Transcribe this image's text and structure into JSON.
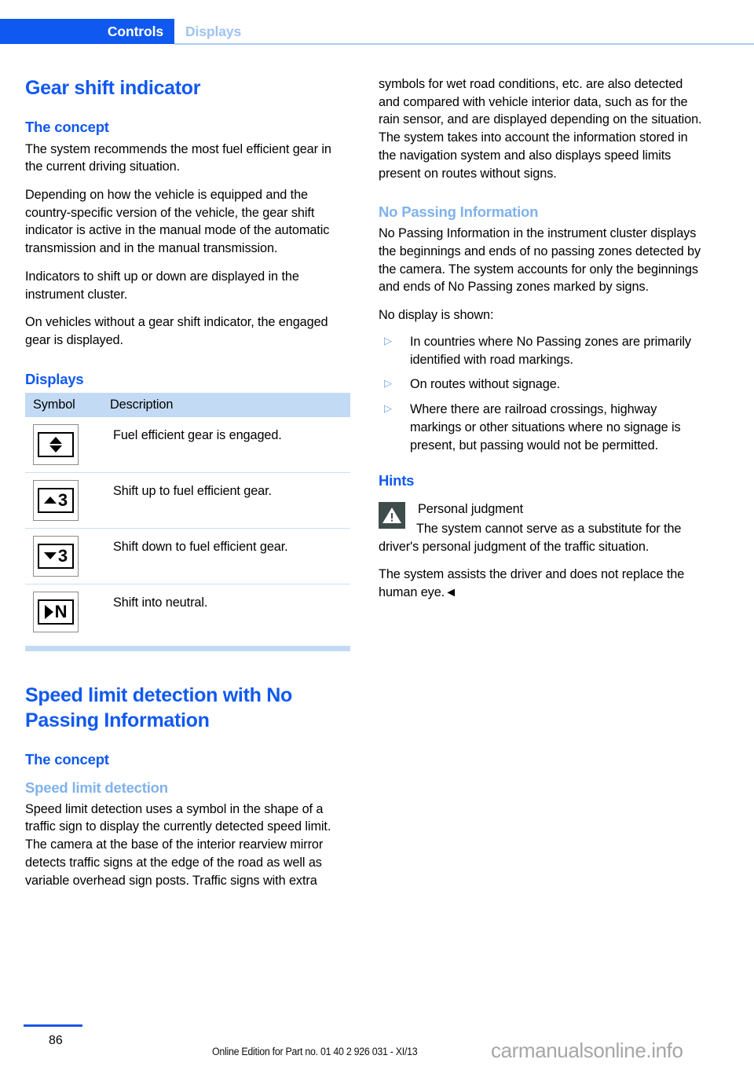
{
  "header": {
    "active_tab": "Controls",
    "inactive_tab": "Displays",
    "accent_blue": "#1059f0",
    "muted_blue": "#9fc3f2"
  },
  "left_column": {
    "title": "Gear shift indicator",
    "concept_heading": "The concept",
    "concept_paragraphs": [
      "The system recommends the most fuel efficient gear in the current driving situation.",
      "Depending on how the vehicle is equipped and the country-specific version of the vehicle, the gear shift indicator is active in the manual mode of the automatic transmission and in the manual transmission.",
      "Indicators to shift up or down are displayed in the instrument cluster.",
      "On vehicles without a gear shift indicator, the engaged gear is displayed."
    ],
    "displays_heading": "Displays",
    "table": {
      "columns": [
        "Symbol",
        "Description"
      ],
      "rows": [
        {
          "symbol": "up-down-arrow-icon",
          "description": "Fuel efficient gear is engaged."
        },
        {
          "symbol": "arrow-up-gear-3-icon",
          "digit": "3",
          "description": "Shift up to fuel efficient gear."
        },
        {
          "symbol": "arrow-down-gear-3-icon",
          "digit": "3",
          "description": "Shift down to fuel efficient gear."
        },
        {
          "symbol": "arrow-right-neutral-icon",
          "digit": "N",
          "description": "Shift into neutral."
        }
      ]
    },
    "section2_title": "Speed limit detection with No Passing Information",
    "section2_concept_heading": "The concept",
    "section2_subheading": "Speed limit detection",
    "section2_paragraph": "Speed limit detection uses a symbol in the shape of a traffic sign to display the currently detected speed limit. The camera at the base of the interior rearview mirror detects traffic signs at the edge of the road as well as variable overhead sign posts. Traffic signs with extra"
  },
  "right_column": {
    "continued_paragraph": "symbols for wet road conditions, etc. are also detected and compared with vehicle interior data, such as for the rain sensor, and are displayed depending on the situation. The system takes into account the information stored in the navigation system and also displays speed limits present on routes without signs.",
    "no_passing_heading": "No Passing Information",
    "no_passing_paragraph": "No Passing Information in the instrument cluster displays the beginnings and ends of no passing zones detected by the camera. The system accounts for only the beginnings and ends of No Passing zones marked by signs.",
    "no_display_intro": "No display is shown:",
    "bullets": [
      "In countries where No Passing zones are primarily identified with road markings.",
      "On routes without signage.",
      "Where there are railroad crossings, highway markings or other situations where no signage is present, but passing would not be permitted."
    ],
    "hints_heading": "Hints",
    "warning_title": "Personal judgment",
    "warning_body": "The system cannot serve as a substitute for the driver's personal judgment of the traffic situation.",
    "warning_closing": "The system assists the driver and does not replace the human eye.◄"
  },
  "footer": {
    "page_number": "86",
    "edition": "Online Edition for Part no. 01 40 2 926 031 - XI/13",
    "watermark": "carmanualsonline.info"
  }
}
